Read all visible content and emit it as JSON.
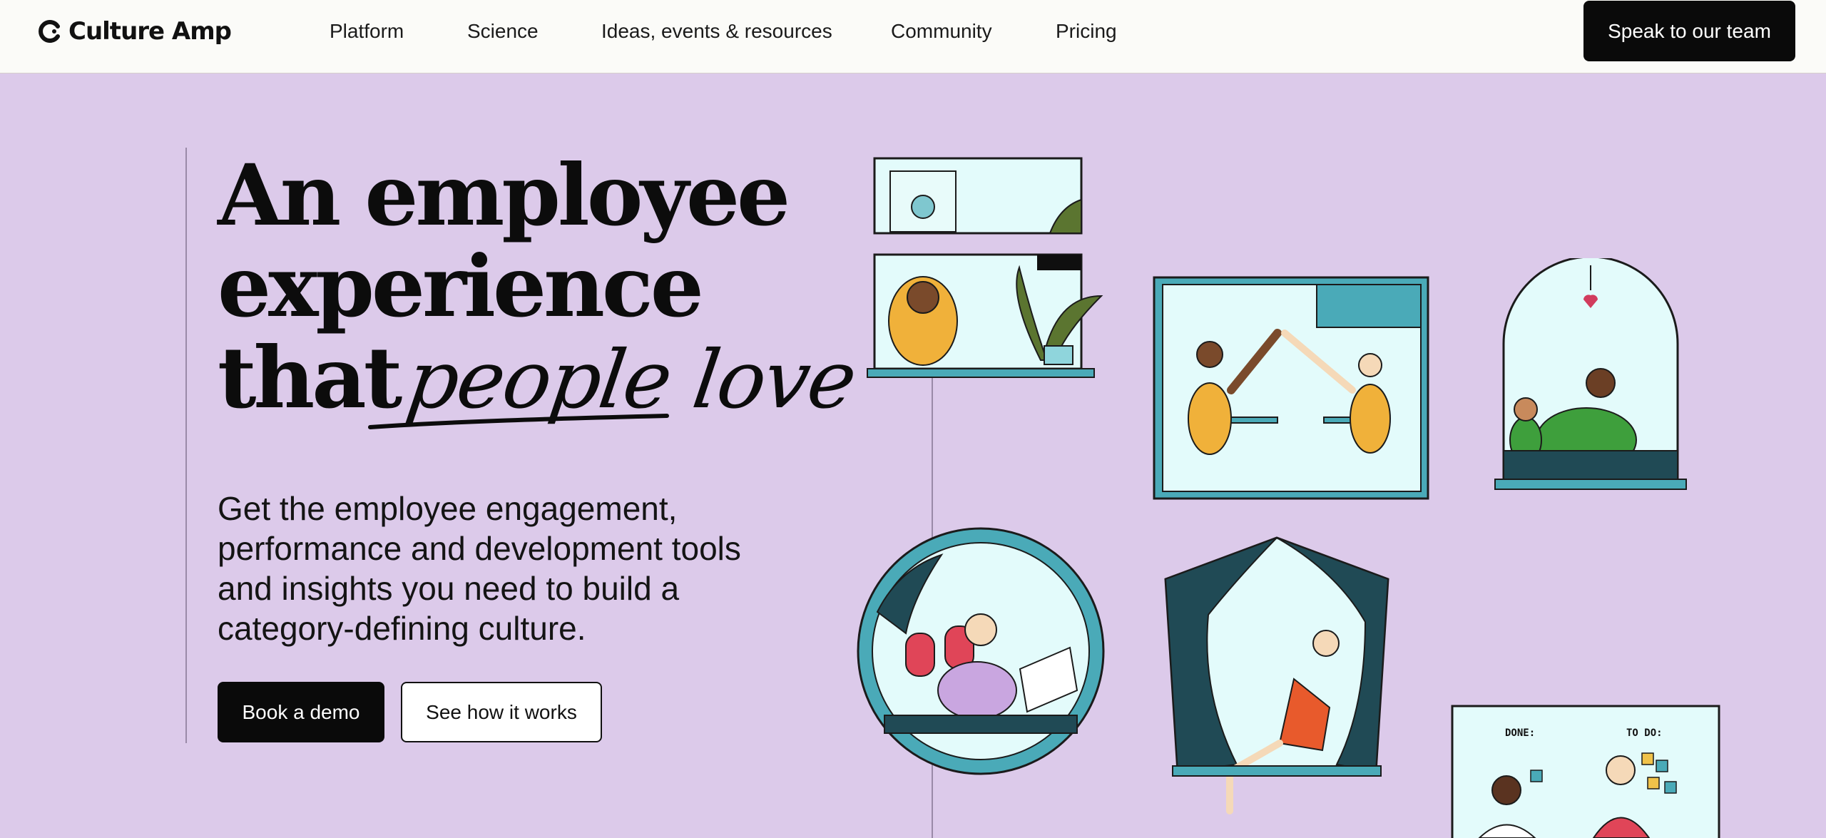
{
  "brand": {
    "name": "Culture Amp"
  },
  "nav": {
    "items": [
      {
        "label": "Platform"
      },
      {
        "label": "Science"
      },
      {
        "label": "Ideas, events & resources"
      },
      {
        "label": "Community"
      },
      {
        "label": "Pricing"
      }
    ],
    "cta_label": "Speak to our team"
  },
  "hero": {
    "title_line1": "An employee",
    "title_line2": "experience",
    "title_line3_prefix": "that",
    "title_line3_script": "people love",
    "subtitle": "Get the employee engagement, performance and development tools and insights you need to build a category-defining culture.",
    "primary_cta": "Book a demo",
    "secondary_cta": "See how it works"
  },
  "illustrations": {
    "kanban_todo": "TO DO:",
    "kanban_done": "DONE:"
  },
  "colors": {
    "page_bg": "#dccaea",
    "header_bg": "#fbfbf8",
    "button_dark": "#0a0a0a",
    "teal": "#4aaab8",
    "dark_teal": "#204a55",
    "pale_cyan": "#e3fbfb"
  },
  "icons": {
    "logo": "culture-amp-c-mark-icon"
  }
}
